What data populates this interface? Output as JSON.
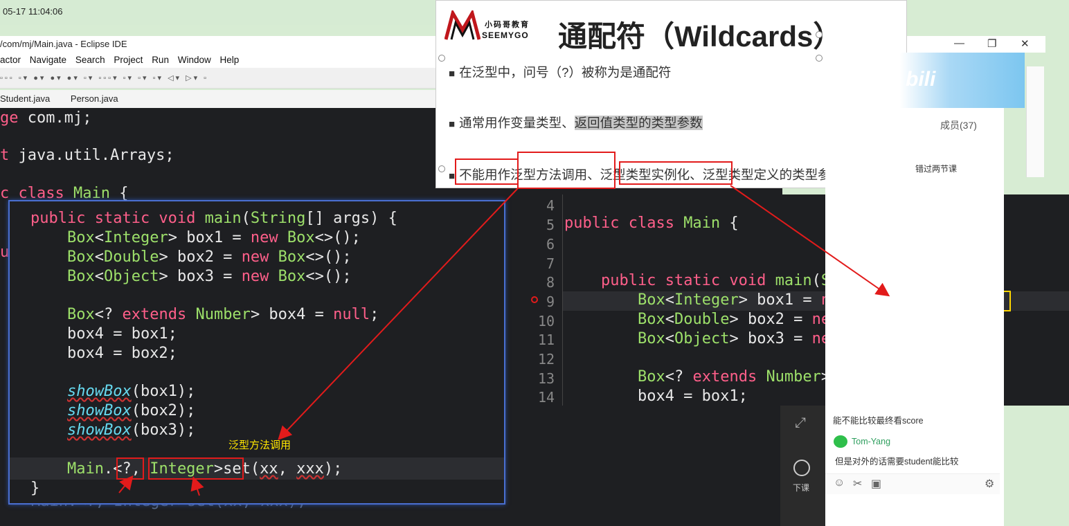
{
  "timestamp": "05-17 11:04:06",
  "eclipse": {
    "title": "/com/mj/Main.java - Eclipse IDE",
    "menu": [
      "actor",
      "Navigate",
      "Search",
      "Project",
      "Run",
      "Window",
      "Help"
    ],
    "tabs": [
      "Student.java",
      "Person.java"
    ]
  },
  "slide": {
    "logo_cn": "小码哥教育",
    "logo_en": "SEEMYGO",
    "title": "通配符（Wildcards）",
    "bullets": [
      "在泛型中，问号（?）被称为是通配符",
      "通常用作变量类型、",
      "返回值类型的类型参数",
      "不能用作",
      "泛型方法调用、",
      "泛型类型实例化、",
      "泛型类型定义的类型参数"
    ]
  },
  "background_code": {
    "line1_a": "ge",
    "line1_b": " com.mj;",
    "line2_a": "t",
    "line2_b": " java.util.Arrays;",
    "line3_a": "c",
    "line3_b": " class ",
    "line3_c": "Main",
    "line3_d": " {",
    "ghost": "Main.<?, Integer>set(xx, xxx);"
  },
  "left_editor": {
    "annotation": "泛型方法调用"
  },
  "right_editor": {
    "line_numbers": [
      "4",
      "5",
      "6",
      "7",
      "8",
      "9",
      "10",
      "11",
      "12",
      "13",
      "14"
    ]
  },
  "chat": {
    "members": "成员(37)",
    "snippet1": "错过两节课",
    "msg1": "能不能比较最终看score",
    "user": "Tom-Yang",
    "msg2": "但是对外的话需要student能比较",
    "class_label": "下课",
    "brand": "bili"
  },
  "colors": {
    "annotation_red": "#e21b1b",
    "highlight_yellow": "#ffd700",
    "editor_bg": "#1e1f22"
  }
}
